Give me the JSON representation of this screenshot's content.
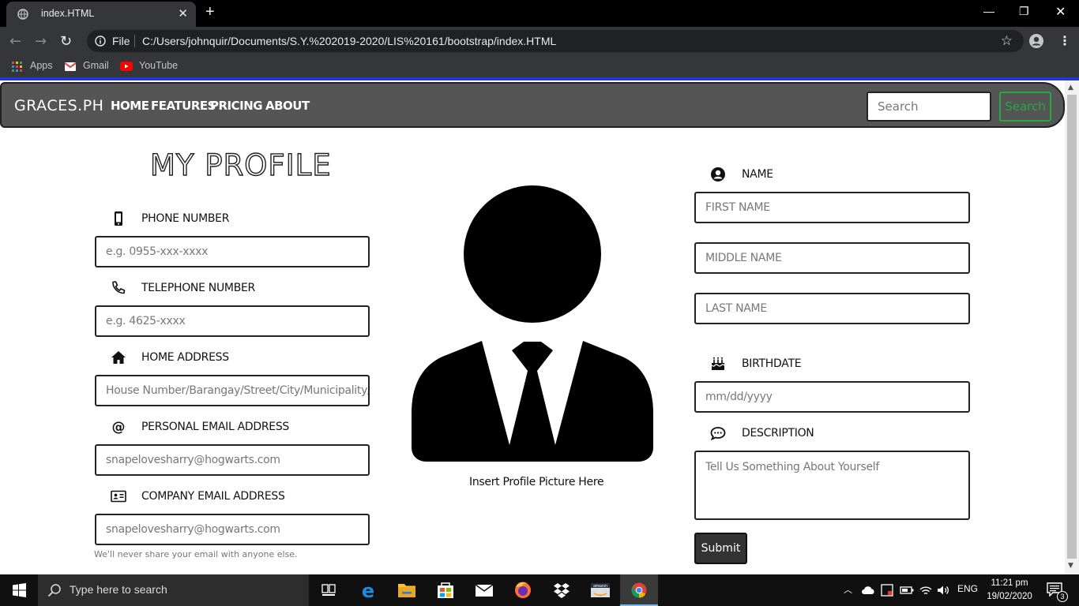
{
  "browser": {
    "tab_title": "index.HTML",
    "address_scheme": "File",
    "url": "C:/Users/johnquir/Documents/S.Y.%202019-2020/LIS%20161/bootstrap/index.HTML",
    "bookmarks": [
      "Apps",
      "Gmail",
      "YouTube"
    ]
  },
  "navbar": {
    "brand": "GRACES.PH",
    "links": [
      "HOME",
      "FEATURES",
      "PRICING",
      "ABOUT"
    ],
    "search_placeholder": "Search",
    "search_button": "Search",
    "search_button_color": "#28a745"
  },
  "profile": {
    "heading": "MY PROFILE",
    "left_fields": [
      {
        "label": "PHONE NUMBER",
        "placeholder": "e.g. 0955-xxx-xxxx",
        "icon": "phone-icon"
      },
      {
        "label": "TELEPHONE NUMBER",
        "placeholder": "e.g. 4625-xxxx",
        "icon": "telephone-icon"
      },
      {
        "label": "HOME ADDRESS",
        "placeholder": "House Number/Barangay/Street/City/Municipality/Pro",
        "icon": "home-icon"
      },
      {
        "label": "PERSONAL EMAIL ADDRESS",
        "placeholder": "snapelovesharry@hogwarts.com",
        "icon": "at-icon"
      },
      {
        "label": "COMPANY EMAIL ADDRESS",
        "placeholder": "snapelovesharry@hogwarts.com",
        "icon": "id-card-icon"
      }
    ],
    "email_help": "We'll never share your email with anyone else.",
    "avatar_caption": "Insert Profile Picture Here",
    "name_label": "NAME",
    "first_name_placeholder": "FIRST NAME",
    "middle_name_placeholder": "MIDDLE NAME",
    "last_name_placeholder": "LAST NAME",
    "birthdate_label": "BIRTHDATE",
    "birthdate_placeholder": "mm/dd/yyyy",
    "description_label": "DESCRIPTION",
    "description_placeholder": "Tell Us Something About Yourself",
    "submit_label": "Submit"
  },
  "taskbar": {
    "search_text": "Type here to search",
    "language": "ENG",
    "time": "11:21 pm",
    "date": "19/02/2020",
    "notification_count": "3"
  }
}
